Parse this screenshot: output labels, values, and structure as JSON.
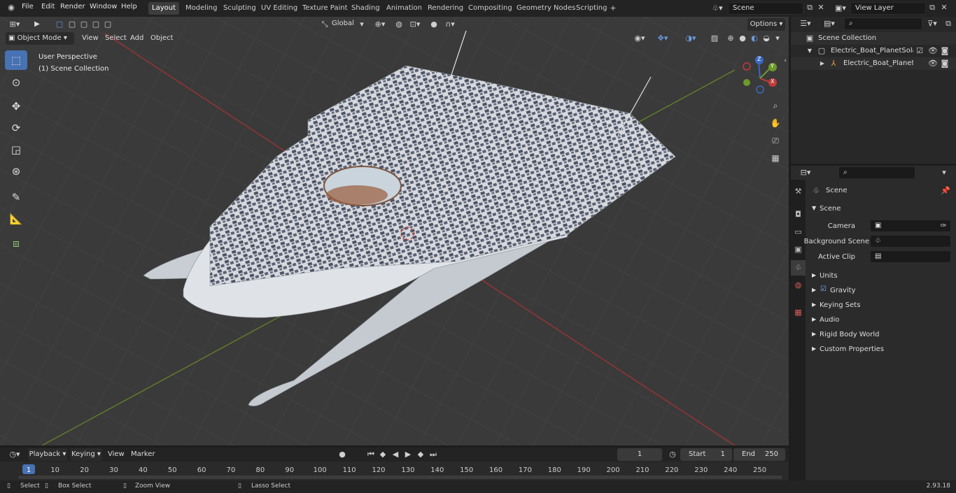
{
  "menus": [
    "File",
    "Edit",
    "Render",
    "Window",
    "Help"
  ],
  "workspaces": [
    "Layout",
    "Modeling",
    "Sculpting",
    "UV Editing",
    "Texture Paint",
    "Shading",
    "Animation",
    "Rendering",
    "Compositing",
    "Geometry Nodes",
    "Scripting"
  ],
  "scene_field": "Scene",
  "view_layer_field": "View Layer",
  "viewport": {
    "mode": "Object Mode",
    "menus": [
      "View",
      "Select",
      "Add",
      "Object"
    ],
    "transform_orientation": "Global",
    "options_label": "Options",
    "perspective_label": "User Perspective",
    "collection_label": "(1) Scene Collection",
    "gizmo": {
      "x": "X",
      "y": "Y",
      "z": "Z"
    }
  },
  "outliner": {
    "root": "Scene Collection",
    "items": [
      {
        "label": "Electric_Boat_PlanetSolar_Sim"
      },
      {
        "label": "Electric_Boat_PlanetSolar"
      }
    ]
  },
  "properties": {
    "header": "Scene",
    "section": "Scene",
    "camera_label": "Camera",
    "background_scene_label": "Background Scene",
    "active_clip_label": "Active Clip",
    "panels": [
      "Units",
      "Gravity",
      "Keying Sets",
      "Audio",
      "Rigid Body World",
      "Custom Properties"
    ]
  },
  "timeline": {
    "menus": [
      "Playback",
      "Keying",
      "View",
      "Marker"
    ],
    "current_frame": "1",
    "start_label": "Start",
    "start_value": "1",
    "end_label": "End",
    "end_value": "250",
    "ruler": [
      "1",
      "10",
      "20",
      "30",
      "40",
      "50",
      "60",
      "70",
      "80",
      "90",
      "100",
      "110",
      "120",
      "130",
      "140",
      "150",
      "160",
      "170",
      "180",
      "190",
      "200",
      "210",
      "220",
      "230",
      "240",
      "250"
    ]
  },
  "status": {
    "select": "Select",
    "box_select": "Box Select",
    "zoom_view": "Zoom View",
    "lasso_select": "Lasso Select",
    "version": "2.93.18"
  },
  "colors": {
    "accent": "#4772b3",
    "x_axis": "#c23a3a",
    "y_axis": "#6d9a2a"
  }
}
